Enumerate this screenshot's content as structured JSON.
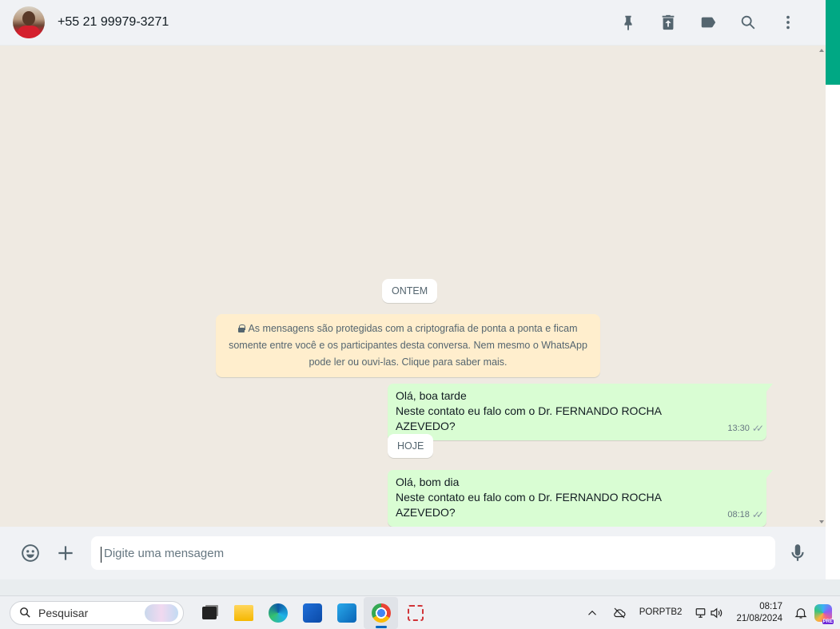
{
  "header": {
    "contact": "+55 21 99979-3271",
    "icons": [
      "pin-icon",
      "delete-icon",
      "label-icon",
      "search-icon",
      "menu-icon"
    ]
  },
  "chat": {
    "date_yesterday": "ONTEM",
    "encryption_notice": "As mensagens são protegidas com a criptografia de ponta a ponta e ficam somente entre você e os participantes desta conversa. Nem mesmo o WhatsApp pode ler ou ouvi-las. Clique para saber mais.",
    "encryption_line1": "As mensagens são protegidas com a criptografia de ponta a ponta e ficam",
    "encryption_line2": "somente entre você e os participantes desta conversa. Nem mesmo o WhatsApp",
    "encryption_line3": "pode ler ou ouvi-las. Clique para saber mais.",
    "messages": [
      {
        "line1": "Olá, boa tarde",
        "line2": "Neste contato eu falo com o Dr.  FERNANDO ROCHA AZEVEDO?",
        "time": "13:30",
        "status": "✓✓"
      },
      {
        "line1": "Olá, bom dia",
        "line2": "Neste contato eu falo com o Dr.  FERNANDO ROCHA AZEVEDO?",
        "time": "08:18",
        "status": "✓✓"
      }
    ],
    "date_today": "HOJE"
  },
  "composer": {
    "placeholder": "Digite uma mensagem"
  },
  "taskbar": {
    "search_label": "Pesquisar",
    "lang_line1": "POR",
    "lang_line2": "PTB2",
    "time": "08:17",
    "date": "21/08/2024",
    "copilot_badge": "PRE"
  },
  "colors": {
    "accent": "#00a884",
    "outgoing_bubble": "#d9fdd3",
    "notice_bg": "#ffeecd",
    "chat_bg": "#efeae2"
  }
}
